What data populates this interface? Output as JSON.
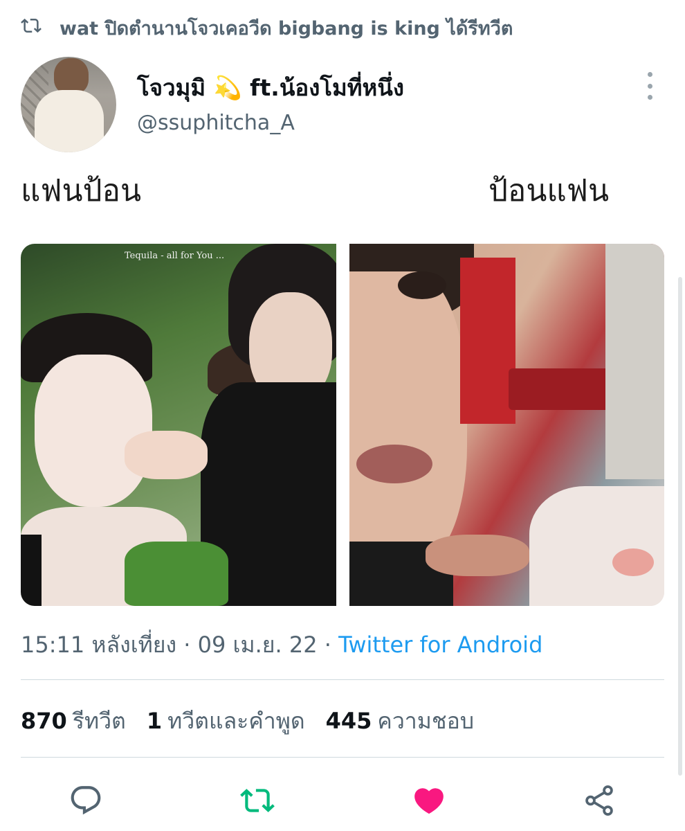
{
  "retweet_context": {
    "icon": "retweet-icon",
    "text": "wat ปิดตำนานโจวเคอวีด bigbang is king ได้รีทวีต"
  },
  "author": {
    "display_name": "โจวมุมิ 💫 ft.น้องโมที่หนึ่ง",
    "handle": "@ssuphitcha_A"
  },
  "tweet": {
    "text_left": "แฟนป้อน",
    "text_right": "ป้อนแฟน"
  },
  "media": {
    "left_caption": "Tequila - all for You  ...",
    "right_caption": ""
  },
  "meta": {
    "time": "15:11 หลังเที่ยง",
    "sep1": " · ",
    "date": "09 เม.ย. 22",
    "sep2": " · ",
    "source": "Twitter for Android"
  },
  "stats": {
    "retweets_count": "870",
    "retweets_label": "รีทวีต",
    "quotes_count": "1",
    "quotes_label": "ทวีตและคำพูด",
    "likes_count": "445",
    "likes_label": "ความชอบ"
  },
  "actions": {
    "reply_icon": "reply-icon",
    "retweet_icon": "retweet-icon",
    "like_icon": "heart-icon",
    "share_icon": "share-icon",
    "retweet_color": "#00ba7c",
    "like_color": "#f91880"
  },
  "colors": {
    "text_primary": "#0f1419",
    "text_secondary": "#536471",
    "link": "#1d9bf0"
  }
}
